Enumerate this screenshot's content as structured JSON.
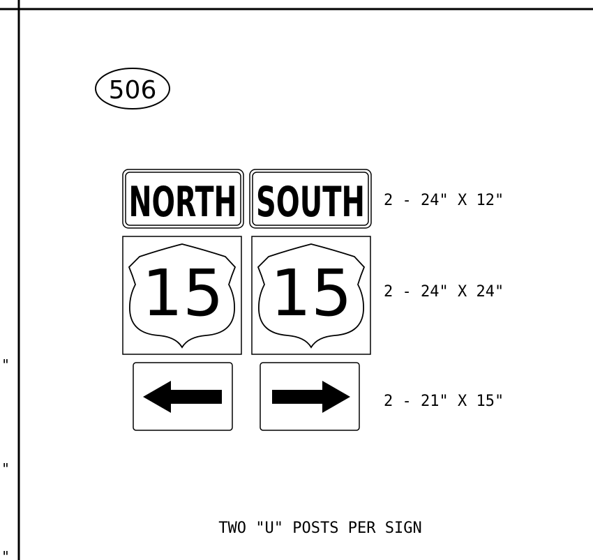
{
  "sheet": {
    "detail_number": "506",
    "footer_note": "TWO \"U\" POSTS PER SIGN",
    "left_edge_marks": [
      "\"",
      "\"",
      "\""
    ]
  },
  "signs": {
    "cardinal": {
      "left_text": "NORTH",
      "right_text": "SOUTH",
      "dimension": "2 - 24\" X 12\""
    },
    "route_shield": {
      "left_number": "15",
      "right_number": "15",
      "dimension": "2 - 24\" X 24\""
    },
    "arrow": {
      "left_direction": "left",
      "right_direction": "right",
      "dimension": "2 - 21\" X 15\""
    }
  }
}
